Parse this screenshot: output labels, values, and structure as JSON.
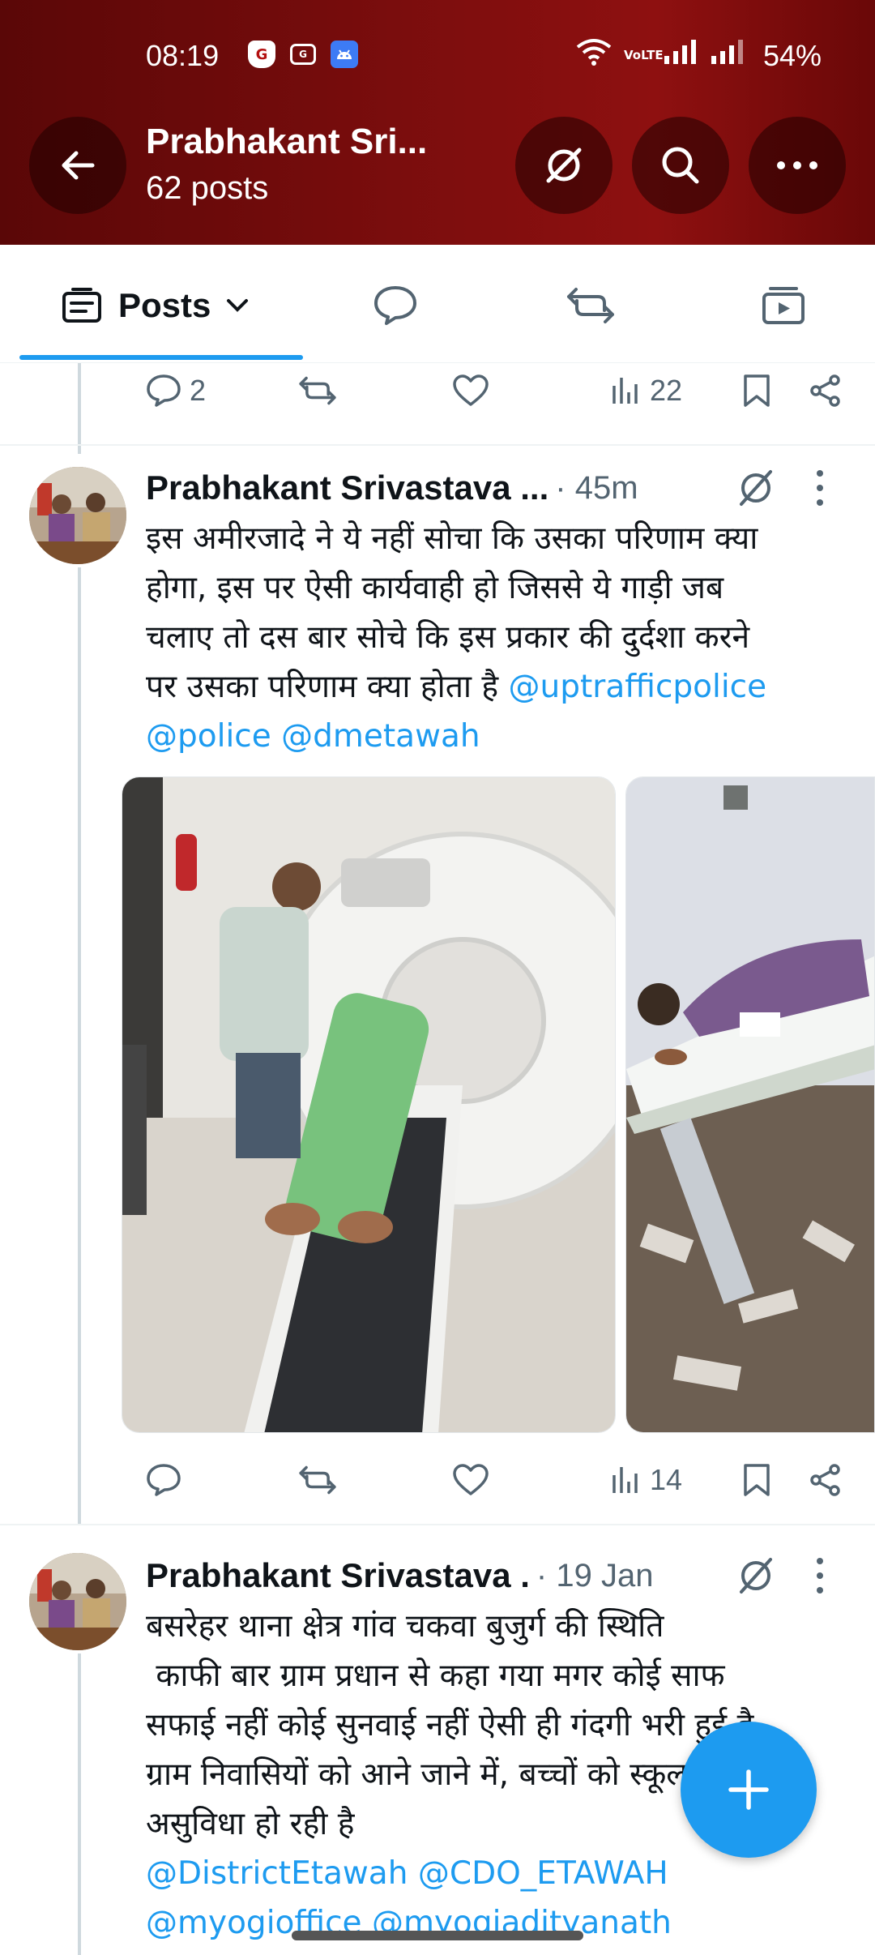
{
  "status_bar": {
    "time": "08:19",
    "battery": "54%",
    "network": "VoLTE",
    "icons": [
      "shield-app-icon",
      "sim-card-icon",
      "android-app-icon",
      "wifi-icon",
      "signal-icon",
      "signal-icon"
    ]
  },
  "header": {
    "title": "Prabhakant Sri...",
    "subtitle": "62 posts",
    "back_icon": "arrow-left-icon",
    "grok_icon": "grok-icon",
    "search_icon": "search-icon",
    "more_icon": "more-horizontal-icon",
    "background_color": "#7a0d0d"
  },
  "tabs": [
    {
      "label": "Posts",
      "icon": "posts-icon",
      "selected": true
    },
    {
      "label": "",
      "icon": "reply-bubble-icon"
    },
    {
      "label": "",
      "icon": "repost-icon"
    },
    {
      "label": "",
      "icon": "media-icon"
    }
  ],
  "accent_color": "#1d9bf0",
  "tweets": [
    {
      "partial": true,
      "actions": {
        "replies": "2",
        "reposts": "",
        "likes": "",
        "views": "22"
      }
    },
    {
      "name": "Prabhakant Srivastava ...",
      "meta": "· 45m",
      "text_lines": [
        "इस अमीरजादे ने ये नहीं सोचा कि उसका परिणाम क्या",
        "होगा, इस पर ऐसी कार्यवाही हो जिससे ये गाड़ी जब",
        "चलाए तो दस बार सोचे कि इस प्रकार की दुर्दशा करने",
        "पर उसका परिणाम क्या होता है "
      ],
      "mentions": [
        "@uptrafficpolice",
        "@police",
        "@dmetawah"
      ],
      "media": [
        "ct-scan-room-photo",
        "patient-on-bed-photo"
      ],
      "actions": {
        "replies": "",
        "reposts": "",
        "likes": "",
        "views": "14"
      }
    },
    {
      "name": "Prabhakant Srivastava .",
      "meta": "· 19 Jan",
      "text_lines": [
        "बसरेहर थाना क्षेत्र गांव चकवा बुजुर्ग की स्थिति",
        " काफी बार ग्राम प्रधान से कहा गया मगर कोई साफ",
        "सफाई नहीं कोई सुनवाई नहीं ऐसी ही गंदगी भरी हुई है",
        "ग्राम निवासियों को आने जाने में, बच्चों को स्कूल जाने में",
        "असुविधा हो रही है"
      ],
      "mentions": [
        "@DistrictEtawah",
        "@CDO_ETAWAH",
        "@myogioffice",
        "@myogiadityanath"
      ]
    }
  ],
  "fab": {
    "icon": "plus-icon"
  }
}
